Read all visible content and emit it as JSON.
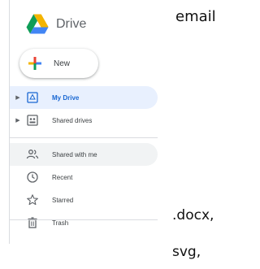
{
  "brand": {
    "name": "Drive",
    "logo": "google-drive-logo"
  },
  "new_button": {
    "label": "New",
    "icon": "plus-icon"
  },
  "nav": {
    "items": [
      {
        "label": "My Drive",
        "icon": "my-drive-icon",
        "expandable": true,
        "active": true
      },
      {
        "label": "Shared drives",
        "icon": "shared-drives-icon",
        "expandable": true,
        "active": false
      },
      {
        "label": "Shared with me",
        "icon": "people-icon",
        "expandable": false,
        "active": false
      },
      {
        "label": "Recent",
        "icon": "clock-icon",
        "expandable": false,
        "active": false
      },
      {
        "label": "Starred",
        "icon": "star-icon",
        "expandable": false,
        "active": false
      },
      {
        "label": "Trash",
        "icon": "trash-icon",
        "expandable": false,
        "active": false
      }
    ]
  },
  "side_notes": {
    "top": "email",
    "middle": ".docx,",
    "bottom": "svg,"
  },
  "colors": {
    "active_bg": "#e8f0fe",
    "active_text": "#1967d2",
    "hover_bg": "#f1f3f4",
    "divider": "#dadce0",
    "drive_green": "#0f9d58",
    "drive_yellow": "#f4b400",
    "drive_blue": "#4285f4",
    "plus_red": "#ea4335"
  }
}
